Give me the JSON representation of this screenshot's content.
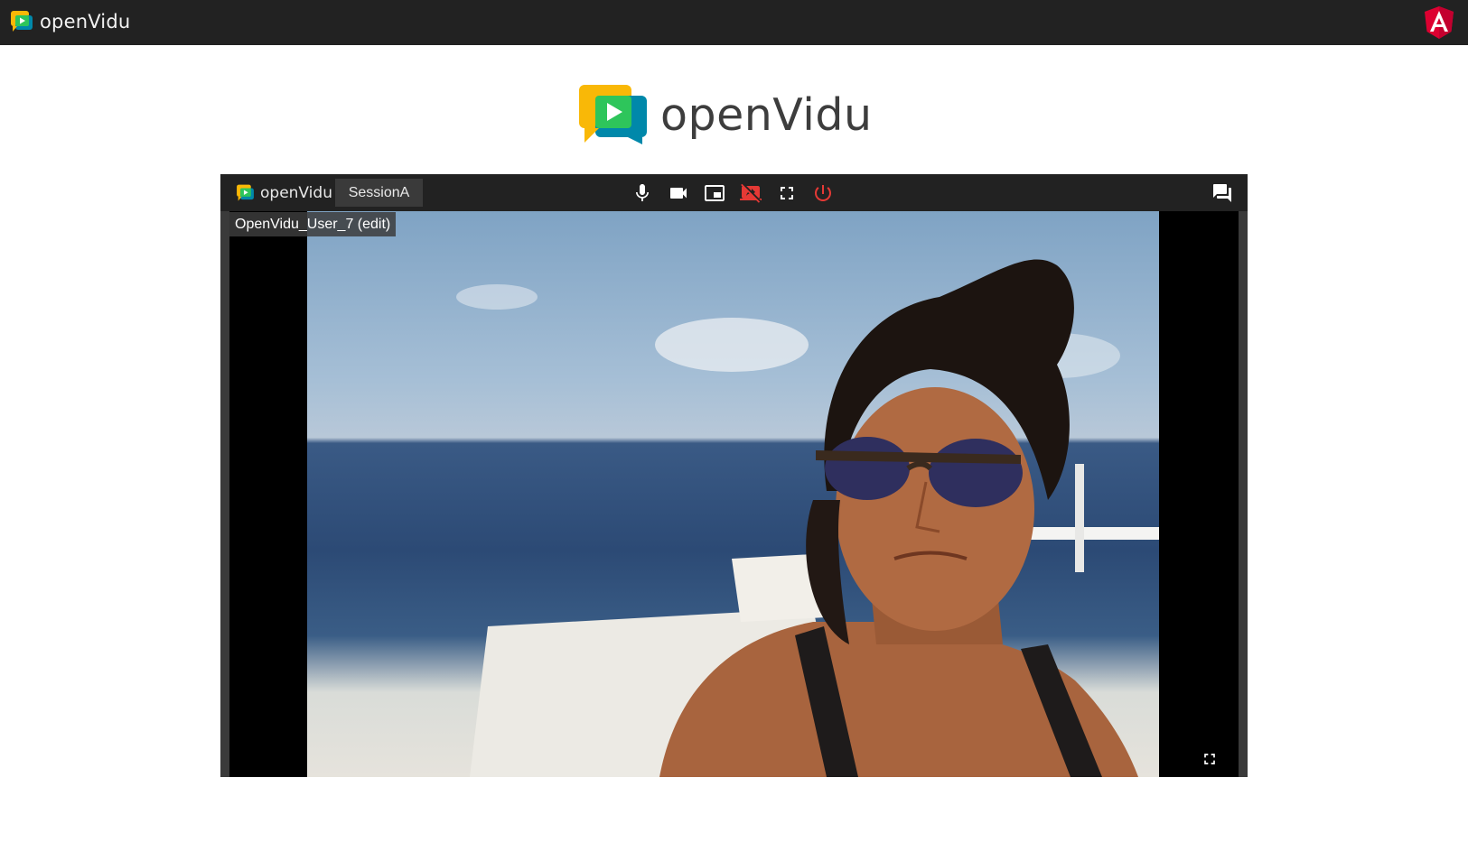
{
  "app": {
    "brand": "openVidu"
  },
  "topbar": {
    "brand_text": "openVidu",
    "angular_logo_icon": "angular-logo-icon"
  },
  "hero": {
    "brand_text": "openVidu"
  },
  "video_toolbar": {
    "brand_text": "openVidu",
    "session_name": "SessionA",
    "controls": [
      {
        "name": "mic-icon",
        "color": "#ffffff"
      },
      {
        "name": "camera-icon",
        "color": "#ffffff"
      },
      {
        "name": "screen-share-icon",
        "color": "#ffffff"
      },
      {
        "name": "stop-screen-share-icon",
        "color": "#e53935"
      },
      {
        "name": "fullscreen-icon",
        "color": "#ffffff"
      },
      {
        "name": "leave-session-icon",
        "color": "#e53935"
      }
    ],
    "chat_icon": "chat-icon"
  },
  "stream": {
    "user_label": "OpenVidu_User_7 (edit)"
  },
  "colors": {
    "topbar_bg": "#222222",
    "toolbar_bg": "#222222",
    "danger": "#e53935",
    "brand_yellow": "#f9b807",
    "brand_green": "#2ec55b",
    "brand_blue": "#0088aa"
  }
}
